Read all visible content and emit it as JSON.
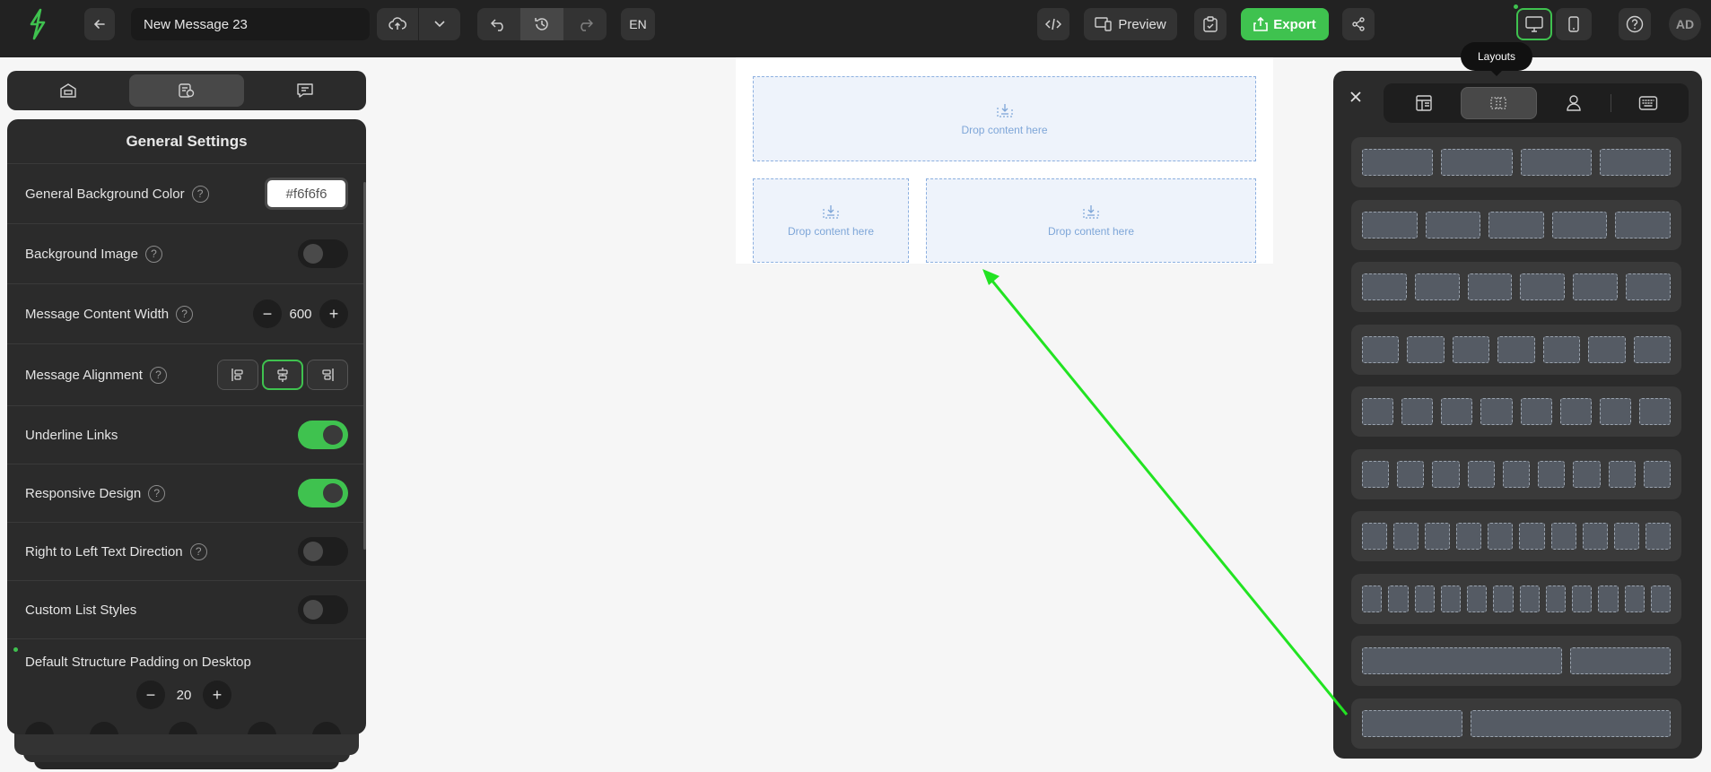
{
  "topbar": {
    "message_title": "New Message 23",
    "language": "EN",
    "preview_label": "Preview",
    "export_label": "Export",
    "avatar_initials": "AD",
    "accent_color": "#3fc24f"
  },
  "left_panel": {
    "title": "General Settings",
    "background_color_label": "General Background Color",
    "background_color_value": "#f6f6f6",
    "background_image_label": "Background Image",
    "content_width_label": "Message Content Width",
    "content_width_value": "600",
    "alignment_label": "Message Alignment",
    "underline_links_label": "Underline Links",
    "responsive_label": "Responsive Design",
    "rtl_label": "Right to Left Text Direction",
    "custom_list_label": "Custom List Styles",
    "padding_label": "Default Structure Padding on Desktop",
    "padding_value": "20",
    "help_symbol": "?",
    "toggles": {
      "background_image": false,
      "underline_links": true,
      "responsive": true,
      "rtl": false,
      "custom_list": false
    },
    "alignment_selected": "center"
  },
  "canvas": {
    "drop_label": "Drop content here"
  },
  "right_panel": {
    "tooltip": "Layouts",
    "active_tab": "layouts",
    "layout_rows": [
      4,
      5,
      6,
      7,
      8,
      9,
      10,
      12,
      "2:1",
      "1:2"
    ]
  }
}
